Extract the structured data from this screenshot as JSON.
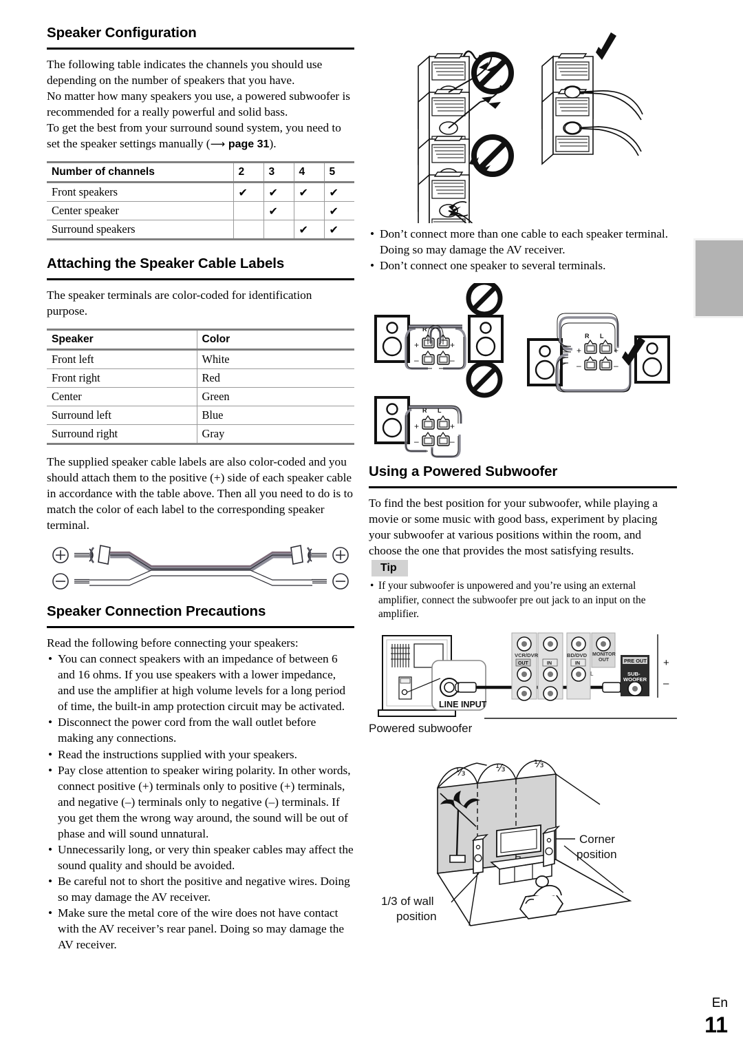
{
  "page": {
    "language_code": "En",
    "page_number": "11"
  },
  "left_column": {
    "section1": {
      "heading": "Speaker Configuration",
      "paragraphs": [
        "The following table indicates the channels you should use depending on the number of speakers that you have.",
        "No matter how many speakers you use, a powered subwoofer is recommended for a really powerful and solid bass."
      ],
      "paragraph3_pre": "To get the best from your surround sound system, you need to set the speaker settings manually (",
      "paragraph3_ref": "page 31",
      "paragraph3_post": ").",
      "channel_table": {
        "header": [
          "Number of channels",
          "2",
          "3",
          "4",
          "5"
        ],
        "rows": [
          {
            "label": "Front speakers",
            "marks": [
              true,
              true,
              true,
              true
            ]
          },
          {
            "label": "Center speaker",
            "marks": [
              false,
              true,
              false,
              true
            ]
          },
          {
            "label": "Surround speakers",
            "marks": [
              false,
              false,
              true,
              true
            ]
          }
        ],
        "check_glyph": "✔"
      }
    },
    "section2": {
      "heading": "Attaching the Speaker Cable Labels",
      "intro": "The speaker terminals are color-coded for identification purpose.",
      "color_table": {
        "header": [
          "Speaker",
          "Color"
        ],
        "rows": [
          [
            "Front left",
            "White"
          ],
          [
            "Front right",
            "Red"
          ],
          [
            "Center",
            "Green"
          ],
          [
            "Surround left",
            "Blue"
          ],
          [
            "Surround right",
            "Gray"
          ]
        ]
      },
      "outro": "The supplied speaker cable labels are also color-coded and you should attach them to the positive (+) side of each speaker cable in accordance with the table above. Then all you need to do is to match the color of each label to the corresponding speaker terminal.",
      "cable_figure": {
        "plus_symbol": "⊕",
        "minus_symbol": "⊖"
      }
    },
    "section3": {
      "heading": "Speaker Connection Precautions",
      "intro": "Read the following before connecting your speakers:",
      "bullets": [
        "You can connect speakers with an impedance of between 6 and 16 ohms. If you use speakers with a lower impedance, and use the amplifier at high volume levels for a long period of time, the built-in amp protection circuit may be activated.",
        "Disconnect the power cord from the wall outlet before making any connections.",
        "Read the instructions supplied with your speakers.",
        "Pay close attention to speaker wiring polarity. In other words, connect positive (+) terminals only to positive (+) terminals, and negative (–) terminals only to negative (–) terminals. If you get them the wrong way around, the sound will be out of phase and will sound unnatural.",
        "Unnecessarily long, or very thin speaker cables may affect the sound quality and should be avoided.",
        "Be careful not to short the positive and negative wires. Doing so may damage the AV receiver.",
        "Make sure the metal core of the wire does not have contact with the AV receiver’s rear panel. Doing so may damage the AV receiver."
      ]
    }
  },
  "right_column": {
    "terminal_figure": {
      "caption_marks": [
        "prohibited",
        "correct",
        "prohibited"
      ]
    },
    "cable_bullets": [
      "Don’t connect more than one cable to each speaker terminal. Doing so may damage the AV receiver.",
      "Don’t connect one speaker to several terminals."
    ],
    "wiring_figure": {
      "terminal_labels": [
        "R",
        "L"
      ],
      "polarity_labels": [
        "+",
        "–"
      ],
      "marks": [
        "prohibited",
        "correct",
        "prohibited"
      ]
    },
    "section_subwoofer": {
      "heading": "Using a Powered Subwoofer",
      "paragraph": "To find the best position for your subwoofer, while playing a movie or some music with good bass, experiment by placing your subwoofer at various positions within the room, and choose the one that provides the most satisfying results.",
      "tip_label": "Tip",
      "tip_bullets": [
        "If your subwoofer is unpowered and you’re using an external amplifier, connect the subwoofer pre out jack to an input on the amplifier."
      ]
    },
    "subwoofer_connection_figure": {
      "subwoofer_caption": "Powered subwoofer",
      "line_input_label": "LINE INPUT",
      "receiver_labels": [
        "VCR/DVR",
        "OUT",
        "IN",
        "BD/DVD",
        "IN",
        "MONITOR",
        "OUT",
        "L"
      ],
      "pre_out_label": "PRE OUT",
      "subwoofer_jack_label": "SUB-\nWOOFER",
      "polarity": [
        "+",
        "–"
      ]
    },
    "room_placement_figure": {
      "fraction_labels": [
        "⅓",
        "⅓",
        "⅓"
      ],
      "corner_label_line1": "Corner",
      "corner_label_line2": "position",
      "wall_label_line1": "1/3 of wall",
      "wall_label_line2": "position"
    }
  }
}
